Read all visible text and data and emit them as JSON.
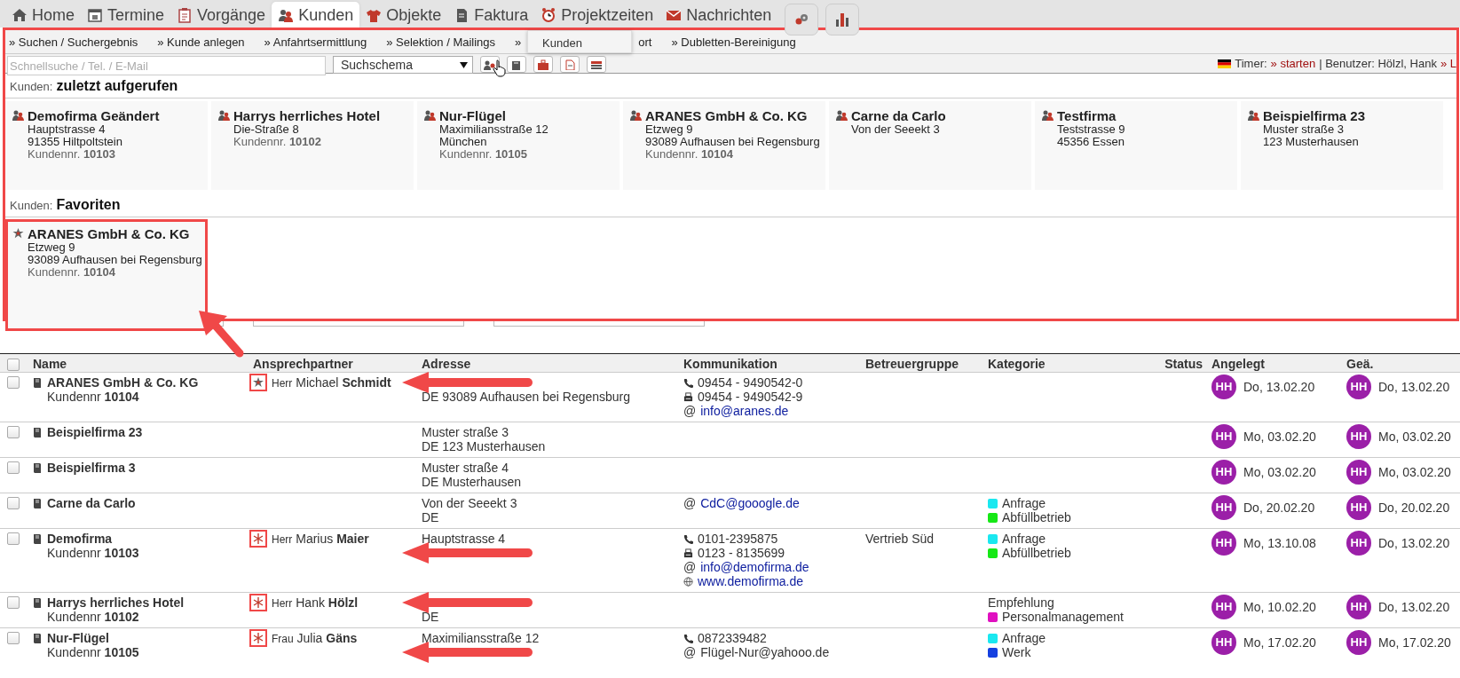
{
  "nav": {
    "items": [
      {
        "label": "Home",
        "selected": false
      },
      {
        "label": "Termine",
        "selected": false
      },
      {
        "label": "Vorgänge",
        "selected": false
      },
      {
        "label": "Kunden",
        "selected": true
      },
      {
        "label": "Objekte",
        "selected": false
      },
      {
        "label": "Faktura",
        "selected": false
      },
      {
        "label": "Projektzeiten",
        "selected": false
      },
      {
        "label": "Nachrichten",
        "selected": false
      }
    ]
  },
  "panel": {
    "highlighted": true,
    "subnav": [
      "» Suchen / Suchergebnis",
      "» Kunde anlegen",
      "» Anfahrtsermittlung",
      "» Selektion / Mailings",
      "»",
      "ort",
      "» Dubletten-Bereinigung"
    ],
    "tooltip": "Kunden",
    "search": {
      "placeholder": "Schnellsuche / Tel. / E-Mail"
    },
    "scheme_select": {
      "value": "Suchschema"
    },
    "timer": {
      "label": "Timer:",
      "start_link": "» starten",
      "user": "| Benutzer: Hölzl, Hank",
      "more_link": "» L"
    },
    "recent": {
      "prefix": "Kunden:",
      "title": "zuletzt aufgerufen",
      "cards": [
        {
          "name": "Demofirma Geändert",
          "lines": [
            "Hauptstrasse 4",
            "91355 Hiltpoltstein"
          ],
          "customer_no": "Kundennr. **10103**",
          "highlighted": false
        },
        {
          "name": "Harrys herrliches Hotel",
          "lines": [
            "Die-Straße 8"
          ],
          "customer_no": "Kundennr. **10102**",
          "highlighted": false
        },
        {
          "name": "Nur-Flügel",
          "lines": [
            "Maximiliansstraße 12",
            "München"
          ],
          "customer_no": "Kundennr. **10105**",
          "highlighted": false
        },
        {
          "name": "ARANES GmbH & Co. KG",
          "lines": [
            "Etzweg 9",
            "93089 Aufhausen bei Regensburg"
          ],
          "customer_no": "Kundennr. **10104**",
          "highlighted": false
        },
        {
          "name": "Carne da Carlo",
          "lines": [
            "Von der Seeekt 3"
          ],
          "highlighted": false
        },
        {
          "name": "Testfirma",
          "lines": [
            "Teststrasse 9",
            "45356 Essen"
          ],
          "highlighted": false
        },
        {
          "name": "Beispielfirma 23",
          "lines": [
            "Muster straße 3",
            "123 Musterhausen"
          ],
          "highlighted": false
        }
      ]
    },
    "favorites": {
      "prefix": "Kunden:",
      "title": "Favoriten",
      "cards": [
        {
          "name": "ARANES GmbH & Co. KG",
          "lines": [
            "Etzweg 9",
            "93089 Aufhausen bei Regensburg"
          ],
          "customer_no": "Kundennr. **10104**",
          "highlighted": true
        }
      ]
    }
  },
  "table": {
    "select_all": {
      "checked": false
    },
    "columns": [
      "Name",
      "Ansprechpartner",
      "Adresse",
      "Kommunikation",
      "Betreuergruppe",
      "Kategorie",
      "Status",
      "Angelegt",
      "Geä."
    ],
    "rows": [
      {
        "checked": false,
        "name": "ARANES GmbH & Co. KG",
        "customer_no": "Kundennr **10104**",
        "contact_mark": {
          "kind": "star",
          "highlighted": true
        },
        "salutation": "Herr",
        "contact": "Michael **Schmidt**",
        "address": [
          {
            "kind": "arrow"
          },
          {
            "kind": "text",
            "text": "DE 93089 Aufhausen bei Regensburg"
          }
        ],
        "communication": [
          {
            "kind": "phone",
            "value": "09454 - 9490542-0"
          },
          {
            "kind": "fax",
            "value": "09454 - 9490542-9"
          },
          {
            "kind": "email",
            "symbol": "@",
            "value": "info@aranes.de",
            "link": true
          }
        ],
        "categories": [],
        "created": {
          "initials": "HH",
          "date": "Do, 13.02.20"
        },
        "changed": {
          "initials": "HH",
          "date": "Do, 13.02.20"
        }
      },
      {
        "checked": false,
        "name": "Beispielfirma 23",
        "address": [
          {
            "kind": "text",
            "text": "Muster straße 3"
          },
          {
            "kind": "text",
            "text": "DE 123 Musterhausen"
          }
        ],
        "communication": [],
        "categories": [],
        "created": {
          "initials": "HH",
          "date": "Mo, 03.02.20"
        },
        "changed": {
          "initials": "HH",
          "date": "Mo, 03.02.20"
        }
      },
      {
        "checked": false,
        "name": "Beispielfirma 3",
        "address": [
          {
            "kind": "text",
            "text": "Muster straße 4"
          },
          {
            "kind": "text",
            "text": "DE Musterhausen"
          }
        ],
        "communication": [],
        "categories": [],
        "created": {
          "initials": "HH",
          "date": "Mo, 03.02.20"
        },
        "changed": {
          "initials": "HH",
          "date": "Mo, 03.02.20"
        }
      },
      {
        "checked": false,
        "name": "Carne da Carlo",
        "address": [
          {
            "kind": "text",
            "text": "Von der Seeekt 3"
          },
          {
            "kind": "text",
            "text": "DE"
          }
        ],
        "communication": [
          {
            "kind": "email",
            "symbol": "@",
            "value": "CdC@gooogle.de",
            "link": true
          }
        ],
        "categories": [
          {
            "label": "Anfrage",
            "color": "#1ae8f0"
          },
          {
            "label": "Abfüllbetrieb",
            "color": "#16e816"
          }
        ],
        "created": {
          "initials": "HH",
          "date": "Do, 20.02.20"
        },
        "changed": {
          "initials": "HH",
          "date": "Do, 20.02.20"
        }
      },
      {
        "checked": false,
        "name": "Demofirma",
        "customer_no": "Kundennr **10103**",
        "contact_mark": {
          "kind": "asterisk",
          "highlighted": true
        },
        "salutation": "Herr",
        "contact": "Marius **Maier**",
        "address": [
          {
            "kind": "text",
            "text": "Hauptstrasse 4"
          },
          {
            "kind": "arrow"
          }
        ],
        "communication": [
          {
            "kind": "phone",
            "value": "0101-2395875"
          },
          {
            "kind": "fax",
            "value": "0123 - 8135699"
          },
          {
            "kind": "email",
            "symbol": "@",
            "value": "info@demofirma.de",
            "link": true
          },
          {
            "kind": "web",
            "value": "www.demofirma.de",
            "link": true
          }
        ],
        "group": "Vertrieb Süd",
        "categories": [
          {
            "label": "Anfrage",
            "color": "#1ae8f0"
          },
          {
            "label": "Abfüllbetrieb",
            "color": "#16e816"
          }
        ],
        "created": {
          "initials": "HH",
          "date": "Mo, 13.10.08"
        },
        "changed": {
          "initials": "HH",
          "date": "Do, 13.02.20"
        }
      },
      {
        "checked": false,
        "name": "Harrys herrliches Hotel",
        "customer_no": "Kundennr **10102**",
        "contact_mark": {
          "kind": "asterisk",
          "highlighted": true
        },
        "salutation": "Herr",
        "contact": "Hank **Hölzl**",
        "address": [
          {
            "kind": "arrow"
          },
          {
            "kind": "text",
            "text": "DE"
          }
        ],
        "communication": [],
        "categories": [
          {
            "label": "Empfehlung"
          },
          {
            "label": "Personalmanagement",
            "color": "#e010c0"
          }
        ],
        "created": {
          "initials": "HH",
          "date": "Mo, 10.02.20"
        },
        "changed": {
          "initials": "HH",
          "date": "Do, 13.02.20"
        }
      },
      {
        "checked": false,
        "name": "Nur-Flügel",
        "customer_no": "Kundennr **10105**",
        "contact_mark": {
          "kind": "asterisk",
          "highlighted": true
        },
        "salutation": "Frau",
        "contact": "Julia **Gäns**",
        "address": [
          {
            "kind": "text",
            "text": "Maximiliansstraße 12"
          },
          {
            "kind": "arrow"
          }
        ],
        "communication": [
          {
            "kind": "phone",
            "value": "0872339482"
          },
          {
            "kind": "email",
            "symbol": "@",
            "value": "Flügel-Nur@yahooo.de",
            "link": false
          }
        ],
        "categories": [
          {
            "label": "Anfrage",
            "color": "#1ae8f0"
          },
          {
            "label": "Werk",
            "color": "#1540e0"
          }
        ],
        "created": {
          "initials": "HH",
          "date": "Mo, 17.02.20"
        },
        "changed": {
          "initials": "HH",
          "date": "Mo, 17.02.20"
        }
      }
    ]
  }
}
